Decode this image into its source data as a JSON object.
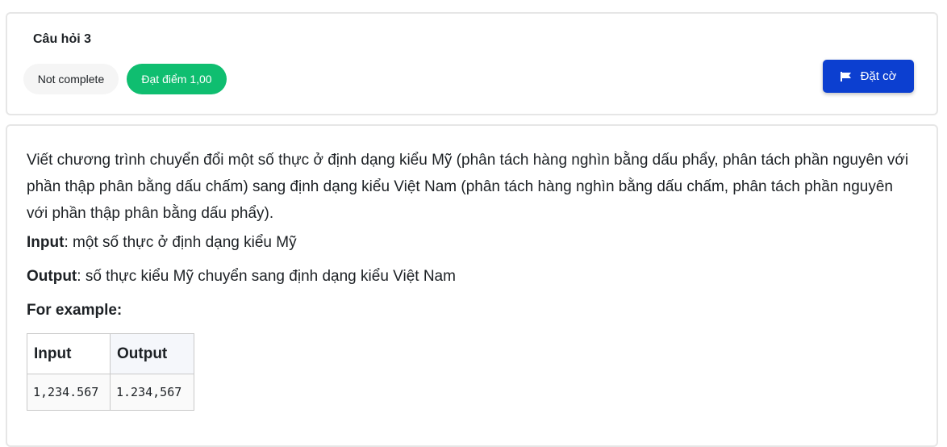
{
  "question": {
    "title": "Câu hỏi 3",
    "status": "Not complete",
    "grade": "Đạt điểm 1,00",
    "flag_label": "Đặt cờ"
  },
  "content": {
    "description": "Viết chương trình chuyển đổi một số thực ở định dạng kiểu Mỹ (phân tách hàng nghìn bằng dấu phẩy, phân tách phần nguyên với phần thập phân bằng dấu chấm) sang định dạng kiểu Việt Nam (phân tách hàng nghìn bằng dấu chấm, phân tách phần nguyên với phần thập phân bằng dấu phẩy).",
    "input_label": "Input",
    "input_text": ": một số thực ở định dạng kiểu Mỹ",
    "output_label": "Output",
    "output_text": ": số thực kiểu Mỹ chuyển sang định dạng kiểu Việt Nam",
    "example_heading": "For example:",
    "table": {
      "headers": [
        "Input",
        "Output"
      ],
      "rows": [
        [
          "1,234.567",
          "1.234,567"
        ]
      ]
    }
  },
  "colors": {
    "grade_badge": "#0fbe70",
    "flag_button": "#0c3fd0",
    "status_badge": "#f5f5f5"
  },
  "icons": {
    "flag": "flag-icon"
  }
}
